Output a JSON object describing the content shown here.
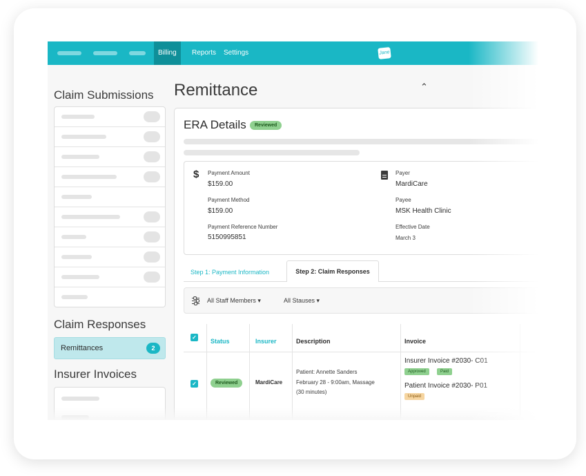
{
  "nav": {
    "billing": "Billing",
    "reports": "Reports",
    "settings": "Settings",
    "logo_text": "Jane"
  },
  "sidebar": {
    "claim_submissions_title": "Claim Submissions",
    "claim_responses_title": "Claim Responses",
    "remittances_label": "Remittances",
    "remittances_count": "2",
    "insurer_invoices_title": "Insurer Invoices"
  },
  "main": {
    "title": "Remittance",
    "era_title": "ERA Details",
    "era_status": "Reviewed",
    "payment_amount_label": "Payment Amount",
    "payment_amount": "$159.00",
    "payment_method_label": "Payment Method",
    "payment_method": "$159.00",
    "payment_ref_label": "Payment Reference Number",
    "payment_ref": "5150995851",
    "payer_label": "Payer",
    "payer": "MardiCare",
    "payee_label": "Payee",
    "payee": "MSK Health Clinic",
    "effective_date_label": "Effective Date",
    "effective_date": "March 3",
    "tabs": {
      "step1": "Step 1: Payment Information",
      "step2": "Step 2: Claim Responses"
    },
    "filters": {
      "staff": "All Staff Members",
      "statuses": "All Stauses"
    },
    "table": {
      "headers": {
        "status": "Status",
        "insurer": "Insurer",
        "description": "Description",
        "invoice": "Invoice"
      },
      "rows": [
        {
          "status": "Reviewed",
          "insurer": "MardiCare",
          "desc_line1": "Patient: Annette Sanders",
          "desc_line2": "February 28 - 9:00am, Massage",
          "desc_line3": "(30 minutes)",
          "insurer_invoice": "Insurer Invoice #2030- C01",
          "insurer_invoice_badge1": "Approved",
          "insurer_invoice_badge2": "Paid",
          "patient_invoice": "Patient Invoice #2030- P01",
          "patient_invoice_badge": "Unpaid"
        }
      ]
    }
  },
  "colors": {
    "brand": "#1ab7c5",
    "brand_dark": "#0f8f99",
    "reviewed_green": "#8fd08f",
    "unpaid_amber": "#f6d5a0"
  }
}
